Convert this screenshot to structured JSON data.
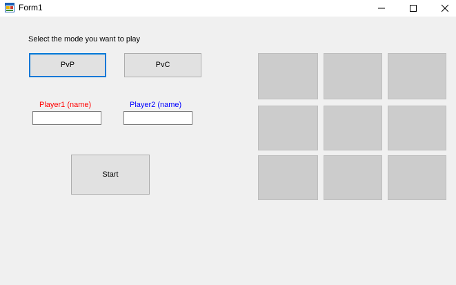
{
  "window": {
    "title": "Form1",
    "controls": {
      "minimize_icon": "minimize-icon",
      "maximize_icon": "maximize-icon",
      "close_icon": "close-icon"
    }
  },
  "mode_select": {
    "prompt": "Select the mode you want to play",
    "pvp_label": "PvP",
    "pvc_label": "PvC",
    "selected": "PvP"
  },
  "players": {
    "player1_label": "Player1 (name)",
    "player1_value": "",
    "player2_label": "Player2 (name)",
    "player2_value": ""
  },
  "start_label": "Start",
  "board": {
    "rows": 3,
    "cols": 3,
    "cells": [
      "",
      "",
      "",
      "",
      "",
      "",
      "",
      "",
      ""
    ]
  },
  "colors": {
    "player1": "#ff0000",
    "player2": "#0000ff",
    "focus_accent": "#0078d7",
    "cell_fill": "#cccccc"
  }
}
